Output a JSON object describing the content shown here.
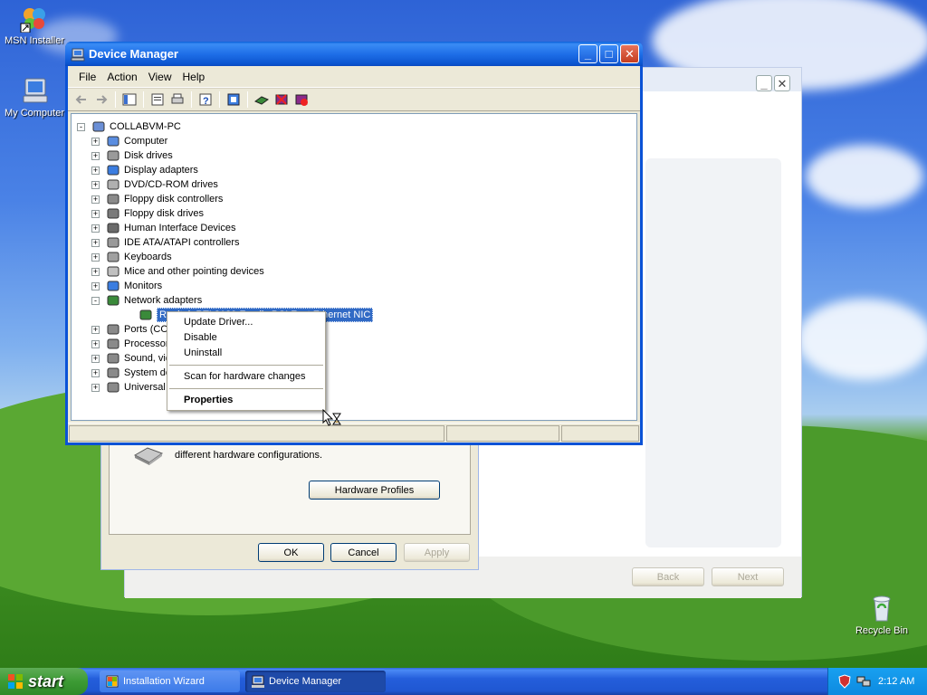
{
  "desktop": {
    "icons": [
      {
        "label": "MSN Installer"
      },
      {
        "label": "My Computer"
      },
      {
        "label": "Recycle Bin"
      }
    ]
  },
  "device_manager": {
    "title": "Device Manager",
    "menu": [
      "File",
      "Action",
      "View",
      "Help"
    ],
    "root": "COLLABVM-PC",
    "categories": [
      "Computer",
      "Disk drives",
      "Display adapters",
      "DVD/CD-ROM drives",
      "Floppy disk controllers",
      "Floppy disk drives",
      "Human Interface Devices",
      "IDE ATA/ATAPI controllers",
      "Keyboards",
      "Mice and other pointing devices",
      "Monitors",
      "Network adapters"
    ],
    "selected_device": "Realtek RTL8139 Family PCI Fast Ethernet NIC",
    "categories_after": [
      "Ports (COM",
      "Processors",
      "Sound, vid",
      "System de",
      "Universal S"
    ]
  },
  "context_menu": {
    "items": [
      "Update Driver...",
      "Disable",
      "Uninstall",
      "Scan for hardware changes",
      "Properties"
    ]
  },
  "system_properties": {
    "description": "different hardware configurations.",
    "hardware_profiles_button": "Hardware Profiles",
    "ok": "OK",
    "cancel": "Cancel",
    "apply": "Apply"
  },
  "installation_wizard": {
    "back": "Back",
    "next": "Next"
  },
  "taskbar": {
    "start": "start",
    "tasks": [
      {
        "label": "Installation Wizard",
        "active": false
      },
      {
        "label": "Device Manager",
        "active": true
      }
    ],
    "clock": "2:12 AM"
  }
}
